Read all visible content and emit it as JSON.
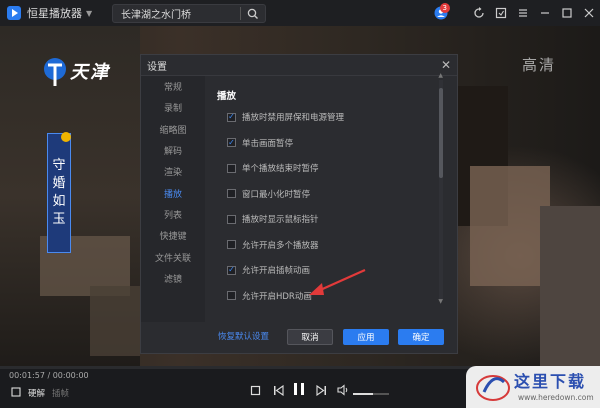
{
  "app": {
    "title": "恒星播放器",
    "search_text": "长津湖之水门桥",
    "notification_count": "3",
    "icons": [
      "chevron-down-icon",
      "search-icon",
      "user-icon",
      "refresh-icon",
      "screenshot-icon",
      "menu-icon",
      "minimize-icon",
      "maximize-icon",
      "close-icon"
    ]
  },
  "video": {
    "channel_name": "天津",
    "hd_label": "高清",
    "show_title": [
      "守",
      "婚",
      "如",
      "玉"
    ]
  },
  "dialog": {
    "title": "设置",
    "close_glyph": "✕",
    "nav": [
      "常规",
      "录制",
      "缩略图",
      "解码",
      "渲染",
      "播放",
      "列表",
      "快捷键",
      "文件关联",
      "滤镜"
    ],
    "active_nav": "播放",
    "section_title": "播放",
    "options": [
      {
        "label": "播放时禁用屏保和电源管理",
        "checked": true
      },
      {
        "label": "单击画面暂停",
        "checked": true
      },
      {
        "label": "单个播放结束时暂停",
        "checked": false
      },
      {
        "label": "窗口最小化时暂停",
        "checked": false
      },
      {
        "label": "播放时显示鼠标指针",
        "checked": false
      },
      {
        "label": "允许开启多个播放器",
        "checked": false
      },
      {
        "label": "允许开启插帧动画",
        "checked": true
      },
      {
        "label": "允许开启HDR动画",
        "checked": false
      }
    ],
    "restore_label": "恢复默认设置",
    "cancel_label": "取消",
    "apply_label": "应用",
    "ok_label": "确定"
  },
  "playback": {
    "time": "00:01:57 / 00:00:00",
    "progress": 0.0,
    "quality_label": "硬解",
    "quality_label2": "插帧",
    "volume": 0.55
  },
  "watermark": {
    "text": "这里下载",
    "url": "www.heredown.com"
  },
  "colors": {
    "accent": "#2b7cf0",
    "dialog_bg": "#2b2c30",
    "arrow": "#e23a3a"
  }
}
